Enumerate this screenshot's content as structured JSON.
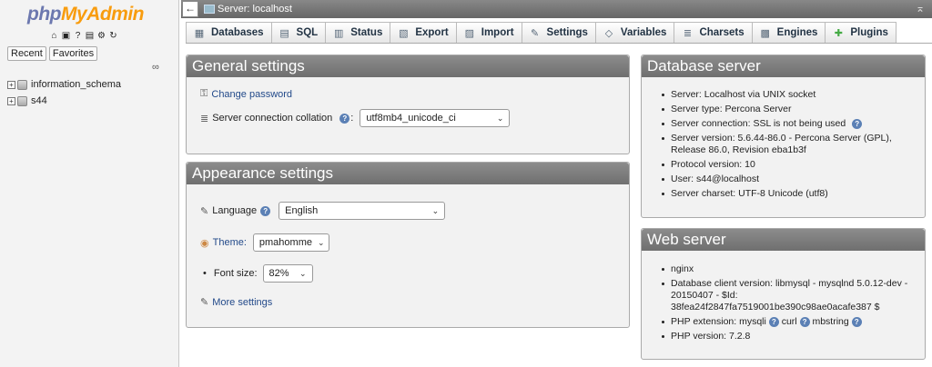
{
  "nav": {
    "logo_a": "php",
    "logo_b": "MyAdmin",
    "tabs": [
      "Recent",
      "Favorites"
    ],
    "databases": [
      "information_schema",
      "s44"
    ]
  },
  "topbar": {
    "title": "Server: localhost"
  },
  "menu": {
    "tabs": [
      {
        "label": "Databases",
        "icon": "database-icon"
      },
      {
        "label": "SQL",
        "icon": "sql-icon"
      },
      {
        "label": "Status",
        "icon": "status-icon"
      },
      {
        "label": "Export",
        "icon": "export-icon"
      },
      {
        "label": "Import",
        "icon": "import-icon"
      },
      {
        "label": "Settings",
        "icon": "wrench-icon"
      },
      {
        "label": "Variables",
        "icon": "variables-icon"
      },
      {
        "label": "Charsets",
        "icon": "charsets-icon"
      },
      {
        "label": "Engines",
        "icon": "engines-icon"
      },
      {
        "label": "Plugins",
        "icon": "plugin-icon"
      }
    ]
  },
  "general": {
    "title": "General settings",
    "change_password": "Change password",
    "collation_label": "Server connection collation",
    "collation_value": "utf8mb4_unicode_ci"
  },
  "appearance": {
    "title": "Appearance settings",
    "language_label": "Language",
    "language_value": "English",
    "theme_label": "Theme:",
    "theme_value": "pmahomme",
    "fontsize_label": "Font size:",
    "fontsize_value": "82%",
    "more_settings": "More settings"
  },
  "dbserver": {
    "title": "Database server",
    "items": [
      "Server: Localhost via UNIX socket",
      "Server type: Percona Server",
      "Server connection: SSL is not being used",
      "Server version: 5.6.44-86.0 - Percona Server (GPL), Release 86.0, Revision eba1b3f",
      "Protocol version: 10",
      "User: s44@localhost",
      "Server charset: UTF-8 Unicode (utf8)"
    ]
  },
  "webserver": {
    "title": "Web server",
    "items": [
      "nginx",
      "Database client version: libmysql - mysqlnd 5.0.12-dev - 20150407 - $Id: 38fea24f2847fa7519001be390c98ae0acafe387 $",
      "PHP extension: mysqli",
      "PHP version: 7.2.8"
    ],
    "ext_curl": "curl",
    "ext_mbstring": "mbstring"
  }
}
